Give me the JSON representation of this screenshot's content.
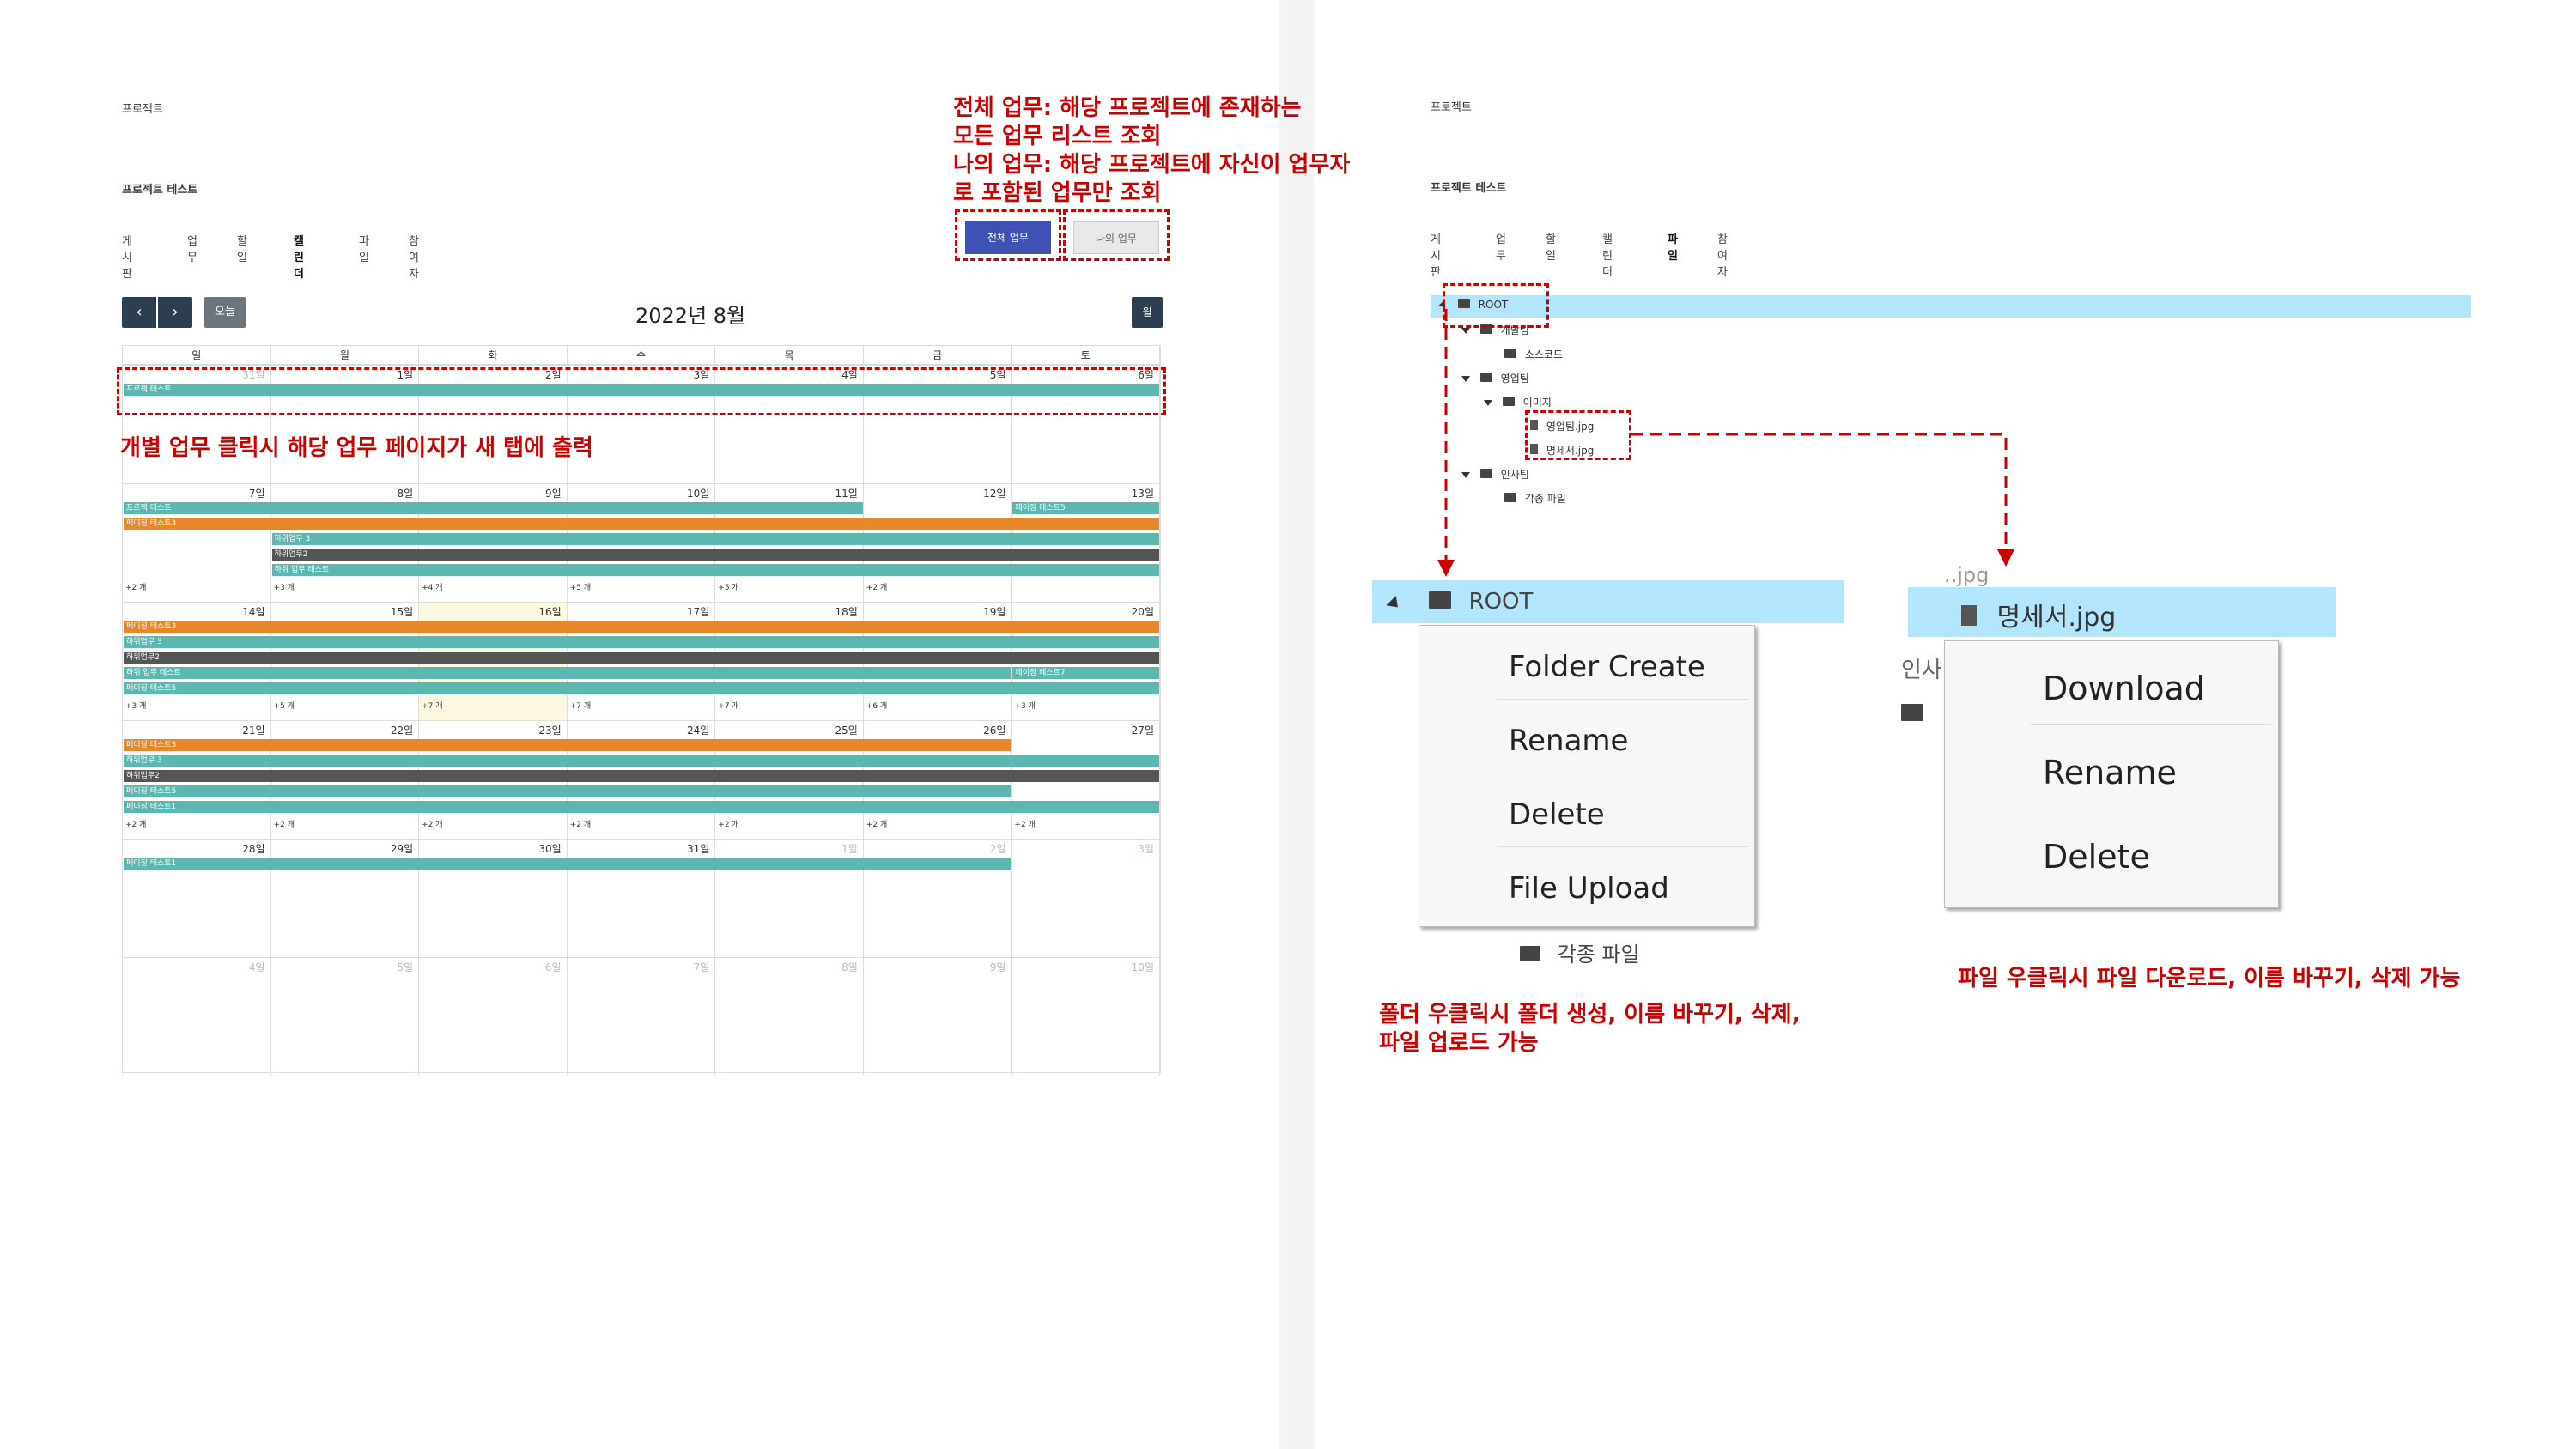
{
  "left": {
    "project_label": "프로젝트",
    "project_name": "프로젝트 테스트",
    "tabs": [
      {
        "label": "게시판"
      },
      {
        "label": "업무"
      },
      {
        "label": "할 일"
      },
      {
        "label": "캘린더"
      },
      {
        "label": "파일"
      },
      {
        "label": "참여자"
      }
    ],
    "view_buttons": {
      "all": "전체 업무",
      "mine": "나의 업무"
    },
    "annotation_top": [
      "전체 업무: 해당 프로젝트에 존재하는",
      "모든 업무 리스트 조회",
      "나의 업무: 해당 프로젝트에 자신이 업무자",
      "로 포함된 업무만 조회"
    ],
    "annotation_mid": "개별 업무 클릭시 해당 업무 페이지가 새 탭에 출력",
    "calendar": {
      "title": "2022년 8월",
      "prev_icon": "‹",
      "next_icon": "›",
      "today_label": "오늘",
      "month_label": "월",
      "weekdays": [
        "일",
        "월",
        "화",
        "수",
        "목",
        "금",
        "토"
      ],
      "weeks": [
        {
          "days": [
            "31일",
            "1일",
            "2일",
            "3일",
            "4일",
            "5일",
            "6일"
          ]
        },
        {
          "days": [
            "7일",
            "8일",
            "9일",
            "10일",
            "11일",
            "12일",
            "13일"
          ]
        },
        {
          "days": [
            "14일",
            "15일",
            "16일",
            "17일",
            "18일",
            "19일",
            "20일"
          ]
        },
        {
          "days": [
            "21일",
            "22일",
            "23일",
            "24일",
            "25일",
            "26일",
            "27일"
          ]
        },
        {
          "days": [
            "28일",
            "29일",
            "30일",
            "31일",
            "1일",
            "2일",
            "3일"
          ]
        },
        {
          "days": [
            "4일",
            "5일",
            "6일",
            "7일",
            "8일",
            "9일",
            "10일"
          ]
        }
      ],
      "events": {
        "w0": [
          "프로젝 테스트"
        ],
        "w1": [
          "프로젝 테스트",
          "페이징 테스트5",
          "페이징 테스트3",
          "하위업무 3",
          "하위업무2",
          "하위 업무 테스트"
        ],
        "w1_more": [
          "+2 개",
          "+3 개",
          "+4 개",
          "+5 개",
          "+5 개",
          "+2 개"
        ],
        "w2": [
          "페이징 테스트3",
          "하위업무 3",
          "하위업무2",
          "하위 업무 테스트",
          "페이징 테스트7",
          "페이징 테스트5"
        ],
        "w2_more": [
          "+3 개",
          "+5 개",
          "+7 개",
          "+7 개",
          "+7 개",
          "+6 개",
          "+3 개"
        ],
        "w3": [
          "페이징 테스트3",
          "하위업무 3",
          "하위업무2",
          "페이징 테스트5",
          "페이징 테스트1"
        ],
        "w3_more": [
          "+2 개",
          "+2 개",
          "+2 개",
          "+2 개",
          "+2 개",
          "+2 개",
          "+2 개"
        ],
        "w4": [
          "페이징 테스트1"
        ]
      },
      "colors": {
        "teal": "#5bb8b0",
        "orange": "#e8862a",
        "dark": "#555555",
        "today_bg": "#fdf8e1"
      }
    }
  },
  "right": {
    "project_label": "프로젝트",
    "project_name": "프로젝트 테스트",
    "tabs": [
      {
        "label": "게시판"
      },
      {
        "label": "업무"
      },
      {
        "label": "할 일"
      },
      {
        "label": "캘린더"
      },
      {
        "label": "파일"
      },
      {
        "label": "참여자"
      }
    ],
    "tree": {
      "root": "ROOT",
      "dev": "개발팀",
      "source": "소스코드",
      "sales": "영업팀",
      "image": "이미지",
      "file1": "영업팀.jpg",
      "file2": "명세서.jpg",
      "hr": "인사팀",
      "misc": "각종 파일"
    },
    "folder_menu": {
      "title": "ROOT",
      "items": [
        "Folder Create",
        "Rename",
        "Delete",
        "File Upload"
      ],
      "below": "각종 파일"
    },
    "file_menu": {
      "title": "명세서.jpg",
      "partial_above": "..jpg",
      "partial_left": "인사",
      "items": [
        "Download",
        "Rename",
        "Delete"
      ]
    },
    "annotation_folder": [
      "폴더 우클릭시 폴더 생성, 이름 바꾸기, 삭제,",
      "파일 업로드 가능"
    ],
    "annotation_file": "파일 우클릭시 파일 다운로드, 이름 바꾸기, 삭제 가능",
    "highlight_color": "#b3e5fc"
  }
}
